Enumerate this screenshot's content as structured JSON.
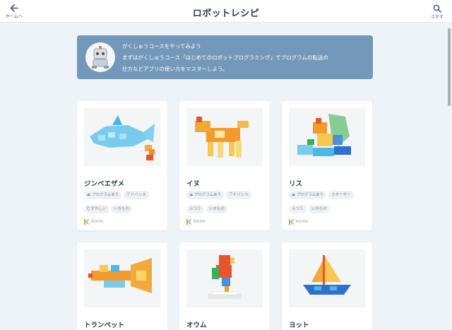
{
  "header": {
    "title": "ロボットレシピ",
    "home_label": "ホームへ",
    "search_label": "さがす"
  },
  "banner": {
    "line1": "がくしゅうコースをやってみよう",
    "line2": "まずはがくしゅうコース「はじめてのロボットプログラミング」でプログラムの転送の",
    "line3": "仕方などアプリの使い方をマスターしよう。"
  },
  "brand": {
    "koov": "KOOV"
  },
  "cards": [
    {
      "name": "ジンベエザメ",
      "tags": [
        "プログラムあり",
        "アドバンス",
        "むずかしい",
        "いきもの"
      ]
    },
    {
      "name": "イヌ",
      "tags": [
        "プログラムあり",
        "アドバンス",
        "ふつう",
        "いきもの"
      ]
    },
    {
      "name": "リス",
      "tags": [
        "プログラムあり",
        "スターター",
        "ふつう",
        "いきもの"
      ]
    },
    {
      "name": "トランペット",
      "tags": []
    },
    {
      "name": "オウム",
      "tags": []
    },
    {
      "name": "ヨット",
      "tags": []
    }
  ],
  "colors": {
    "banner_bg": "#7498b9",
    "accent": "#3d5f86",
    "page_bg": "#eef3f7"
  }
}
